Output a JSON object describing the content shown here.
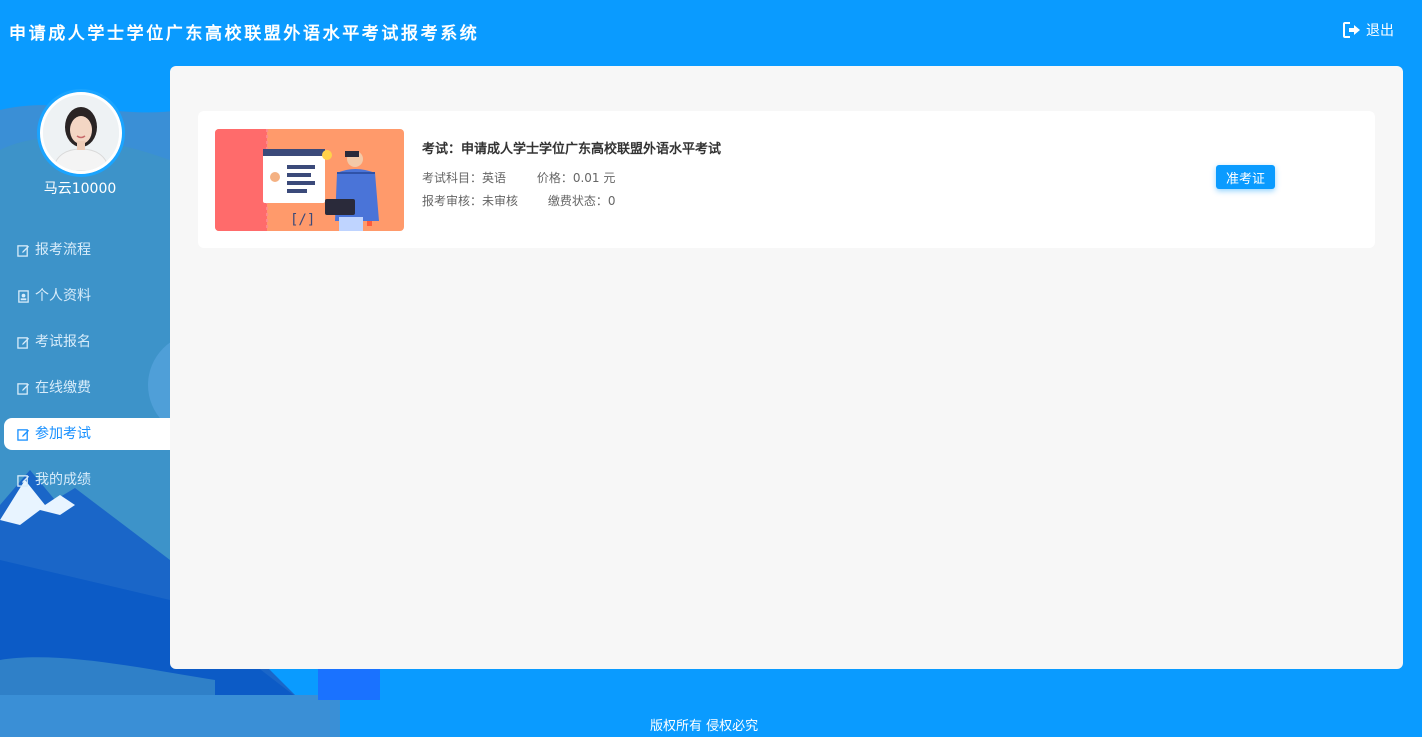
{
  "header": {
    "title": "申请成人学士学位广东高校联盟外语水平考试报考系统",
    "logout_label": "退出"
  },
  "user": {
    "name": "马云10000"
  },
  "nav": {
    "items": [
      {
        "label": "报考流程",
        "icon": "edit-icon"
      },
      {
        "label": "个人资料",
        "icon": "id-card-icon"
      },
      {
        "label": "考试报名",
        "icon": "edit-icon"
      },
      {
        "label": "在线缴费",
        "icon": "edit-icon"
      },
      {
        "label": "参加考试",
        "icon": "edit-icon",
        "active": true
      },
      {
        "label": "我的成绩",
        "icon": "edit-icon"
      }
    ]
  },
  "exam": {
    "title": "考试：申请成人学士学位广东高校联盟外语水平考试",
    "subject": "考试科目：英语",
    "price": "价格：0.01 元",
    "review": "报考审核：未审核",
    "payment": "缴费状态：0",
    "ticket_label": "准考证"
  },
  "footer": {
    "copyright": "版权所有 侵权必究"
  },
  "colors": {
    "primary": "#0a9bff",
    "active_text": "#1890ff",
    "footer_bg": "#3399ff"
  }
}
